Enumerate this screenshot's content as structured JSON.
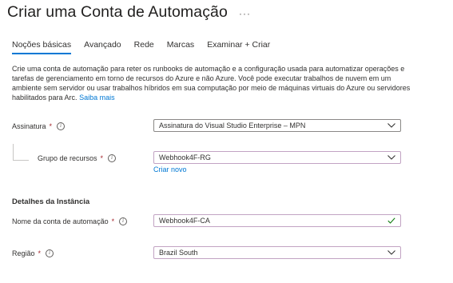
{
  "header": {
    "title": "Criar uma Conta de Automação",
    "more_glyph": "···"
  },
  "tabs": [
    {
      "label": "Noções básicas",
      "active": true
    },
    {
      "label": "Avançado",
      "active": false
    },
    {
      "label": "Rede",
      "active": false
    },
    {
      "label": "Marcas",
      "active": false
    },
    {
      "label": "Examinar + Criar",
      "active": false
    }
  ],
  "description": {
    "text": "Crie uma conta de automação para reter os runbooks de automação e a configuração usada para automatizar operações e tarefas de gerenciamento em torno de recursos do Azure e não Azure. Você pode executar trabalhos de nuvem em um ambiente sem servidor ou usar trabalhos híbridos em sua computação por meio de máquinas virtuais do Azure ou servidores habilitados para Arc.",
    "link": "Saiba mais"
  },
  "subscription": {
    "label": "Assinatura",
    "required_mark": "*",
    "value": "Assinatura do Visual Studio Enterprise – MPN",
    "icon": "chevron-down-icon"
  },
  "resource_group": {
    "label": "Grupo de recursos",
    "required_mark": "*",
    "value": "Webhook4F-RG",
    "icon": "chevron-down-icon",
    "create_new": "Criar novo"
  },
  "instance_section": {
    "heading": "Detalhes da Instância"
  },
  "account_name": {
    "label": "Nome da conta de automação",
    "required_mark": "*",
    "value": "Webhook4F-CA",
    "icon": "checkmark-icon"
  },
  "region": {
    "label": "Região",
    "required_mark": "*",
    "value": "Brazil South",
    "icon": "chevron-down-icon"
  },
  "colors": {
    "accent": "#0078d4",
    "required": "#a4262c",
    "valid": "#107c10",
    "focused_border": "#c2a3c3"
  }
}
